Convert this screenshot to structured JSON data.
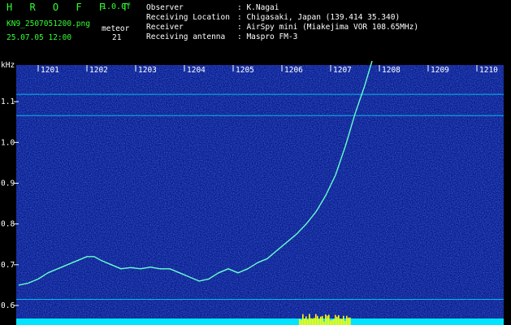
{
  "header": {
    "brand": "H R O F F T",
    "version": "1.0.0f",
    "filename": "KN9_2507051200.png",
    "datetime": "25.07.05 12:00",
    "meteor_label": "meteor",
    "meteor_count": "21",
    "info": [
      {
        "label": "Observer",
        "value": ": K.Nagai"
      },
      {
        "label": "Receiving Location",
        "value": ": Chigasaki, Japan (139.414 35.340)"
      },
      {
        "label": "Receiver",
        "value": ": AirSpy mini (Miakejima VOR 108.65MHz)"
      },
      {
        "label": "Receiving antenna",
        "value": ": Maspro FM-3"
      }
    ]
  },
  "chart_data": {
    "type": "spectrogram",
    "ylabel": "kHz",
    "y_ticks": [
      "1.1",
      "1.0",
      "0.9",
      "0.8",
      "0.7",
      "0.6"
    ],
    "y_values": [
      1.1,
      1.0,
      0.9,
      0.8,
      0.7,
      0.6
    ],
    "x_ticks": [
      "1201",
      "1202",
      "1203",
      "1204",
      "1205",
      "1206",
      "1207",
      "1208",
      "1209",
      "1210"
    ],
    "x_values": [
      1201,
      1202,
      1203,
      1204,
      1205,
      1206,
      1207,
      1208,
      1209,
      1210
    ],
    "xlim": [
      1200.55,
      1210.55
    ],
    "ylim": [
      0.58,
      1.19
    ],
    "horizontal_lines_khz": [
      1.118,
      1.066,
      0.615
    ],
    "trace": {
      "x": [
        1200.6,
        1200.8,
        1201.0,
        1201.2,
        1201.4,
        1201.6,
        1201.8,
        1202.0,
        1202.15,
        1202.3,
        1202.5,
        1202.7,
        1202.9,
        1203.1,
        1203.3,
        1203.5,
        1203.7,
        1203.9,
        1204.1,
        1204.3,
        1204.5,
        1204.7,
        1204.9,
        1205.1,
        1205.3,
        1205.5,
        1205.7,
        1205.9,
        1206.1,
        1206.3,
        1206.5,
        1206.7,
        1206.9,
        1207.1,
        1207.3,
        1207.5,
        1207.7,
        1207.85
      ],
      "y": [
        0.65,
        0.655,
        0.665,
        0.68,
        0.69,
        0.7,
        0.71,
        0.72,
        0.72,
        0.71,
        0.7,
        0.69,
        0.693,
        0.69,
        0.694,
        0.69,
        0.69,
        0.68,
        0.67,
        0.66,
        0.665,
        0.68,
        0.69,
        0.68,
        0.69,
        0.705,
        0.715,
        0.735,
        0.755,
        0.775,
        0.8,
        0.83,
        0.87,
        0.92,
        0.99,
        1.07,
        1.14,
        1.2
      ]
    },
    "colors": {
      "background": "#000000",
      "noise_base": "#0a1a8c",
      "grid_line": "#00e5ff",
      "trace": "#66ffcc",
      "bottom_bar": "#00e5ff",
      "meteor_burst": "#ffff00"
    }
  }
}
